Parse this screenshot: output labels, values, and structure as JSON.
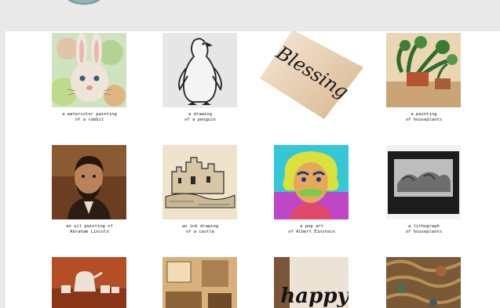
{
  "gallery": {
    "rows": [
      [
        {
          "caption": "a watercolor painting\nof a rabbit",
          "image": "rabbit-watercolor"
        },
        {
          "caption": "a drawing\nof a penguin",
          "image": "penguin-drawing"
        },
        {
          "caption": "",
          "image": "blessing-calligraphy",
          "text_art": "Blessing"
        },
        {
          "caption": "a painting\nof houseplants",
          "image": "houseplants-painting"
        }
      ],
      [
        {
          "caption": "an oil painting of\nAbraham Lincoln",
          "image": "lincoln-oil"
        },
        {
          "caption": "an ink drawing\nof a castle",
          "image": "castle-ink"
        },
        {
          "caption": "a pop art\nof Albert Einstein",
          "image": "einstein-popart"
        },
        {
          "caption": "a lithograph\nof houseplants",
          "image": "houseplants-lithograph"
        }
      ],
      [
        {
          "caption": "",
          "image": "teapots-painting"
        },
        {
          "caption": "",
          "image": "room-interior"
        },
        {
          "caption": "",
          "image": "happy-calligraphy",
          "text_art": "happy"
        },
        {
          "caption": "",
          "image": "tapestry-texture"
        }
      ]
    ]
  }
}
